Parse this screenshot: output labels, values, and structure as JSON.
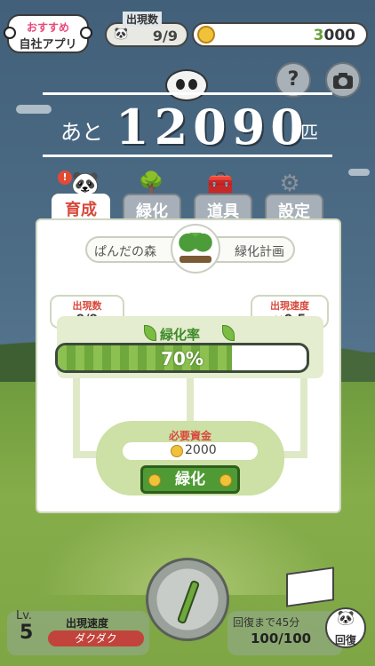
{
  "top": {
    "recommend_line1": "おすすめ",
    "recommend_line2": "自社アプリ",
    "count_label": "出現数",
    "count_value": "9/9",
    "coin_prefix": "3",
    "coin_value": "000"
  },
  "buttons": {
    "help": "?",
    "camera_icon": "camera-icon"
  },
  "counter": {
    "prefix": "あと",
    "number": "12090",
    "suffix": "匹"
  },
  "tabs": [
    {
      "label": "育成",
      "active": true
    },
    {
      "label": "緑化",
      "active": false
    },
    {
      "label": "道具",
      "active": false
    },
    {
      "label": "設定",
      "active": false
    }
  ],
  "alert_mark": "!",
  "panel": {
    "plan_left": "ぱんだの森",
    "plan_right": "緑化計画",
    "appear_count_label": "出現数",
    "appear_count_value": "9/9",
    "appear_speed_label": "出現速度",
    "appear_speed_value": "×0.5",
    "rate_label": "緑化率",
    "rate_value": "70%",
    "rate_fraction": 0.7,
    "cost_label": "必要資金",
    "cost_value": "2000",
    "action_label": "緑化"
  },
  "bottom": {
    "level_prefix": "Lv.",
    "level_value": "5",
    "speed_label": "出現速度",
    "speed_value": "ダクダク",
    "recover_label": "回復まで45分",
    "recover_value": "100/100",
    "recover_button": "回復"
  },
  "colors": {
    "accent_red": "#d7493b",
    "leaf_green": "#6fa83c",
    "coin": "#f0c23a"
  }
}
